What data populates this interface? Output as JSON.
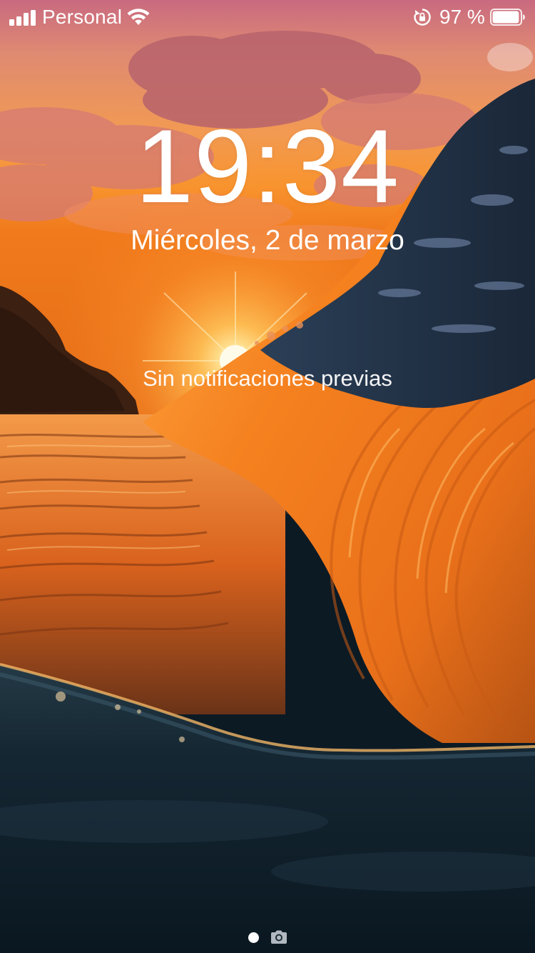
{
  "status_bar": {
    "carrier": "Personal",
    "signal_bars": 4,
    "battery_percent_text": "97 %",
    "battery_level": 0.97,
    "icons": [
      "signal-icon",
      "wifi-icon",
      "rotation-lock-icon",
      "battery-icon"
    ]
  },
  "lock_screen": {
    "time": "19:34",
    "date": "Miércoles, 2 de marzo",
    "notifications_text": "Sin notificaciones previas"
  },
  "page_indicators": {
    "items": [
      "page-dot",
      "camera-icon"
    ],
    "active_index": 0
  },
  "colors": {
    "text": "#ffffff",
    "sky_top": "#d9846c",
    "sun": "#ffd86a",
    "wave_orange": "#f57b1d",
    "deep_water": "#0c1a24"
  }
}
